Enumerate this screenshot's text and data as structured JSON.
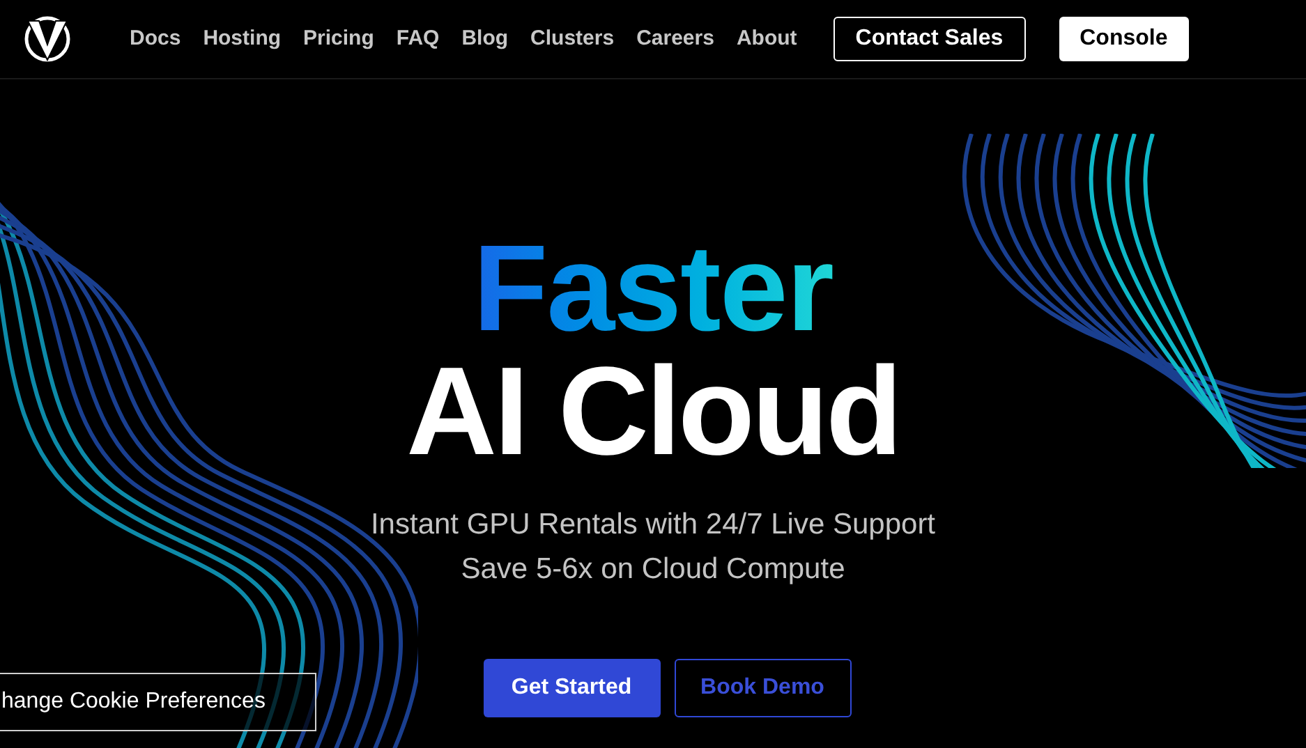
{
  "nav": {
    "links": [
      "Docs",
      "Hosting",
      "Pricing",
      "FAQ",
      "Blog",
      "Clusters",
      "Careers",
      "About"
    ],
    "buttons": [
      {
        "label": "Contact Sales",
        "kind": "outline"
      },
      {
        "label": "Console",
        "kind": "solid"
      }
    ]
  },
  "hero": {
    "title_top": "Faster",
    "title_bottom": "AI Cloud",
    "subtitle_lines": [
      "Instant GPU Rentals with 24/7 Live Support",
      "Save 5-6x on Cloud Compute"
    ],
    "buttons": [
      {
        "label": "Get Started",
        "kind": "solid"
      },
      {
        "label": "Book Demo",
        "kind": "outline"
      }
    ]
  },
  "cookie_button": "hange Cookie Preferences"
}
